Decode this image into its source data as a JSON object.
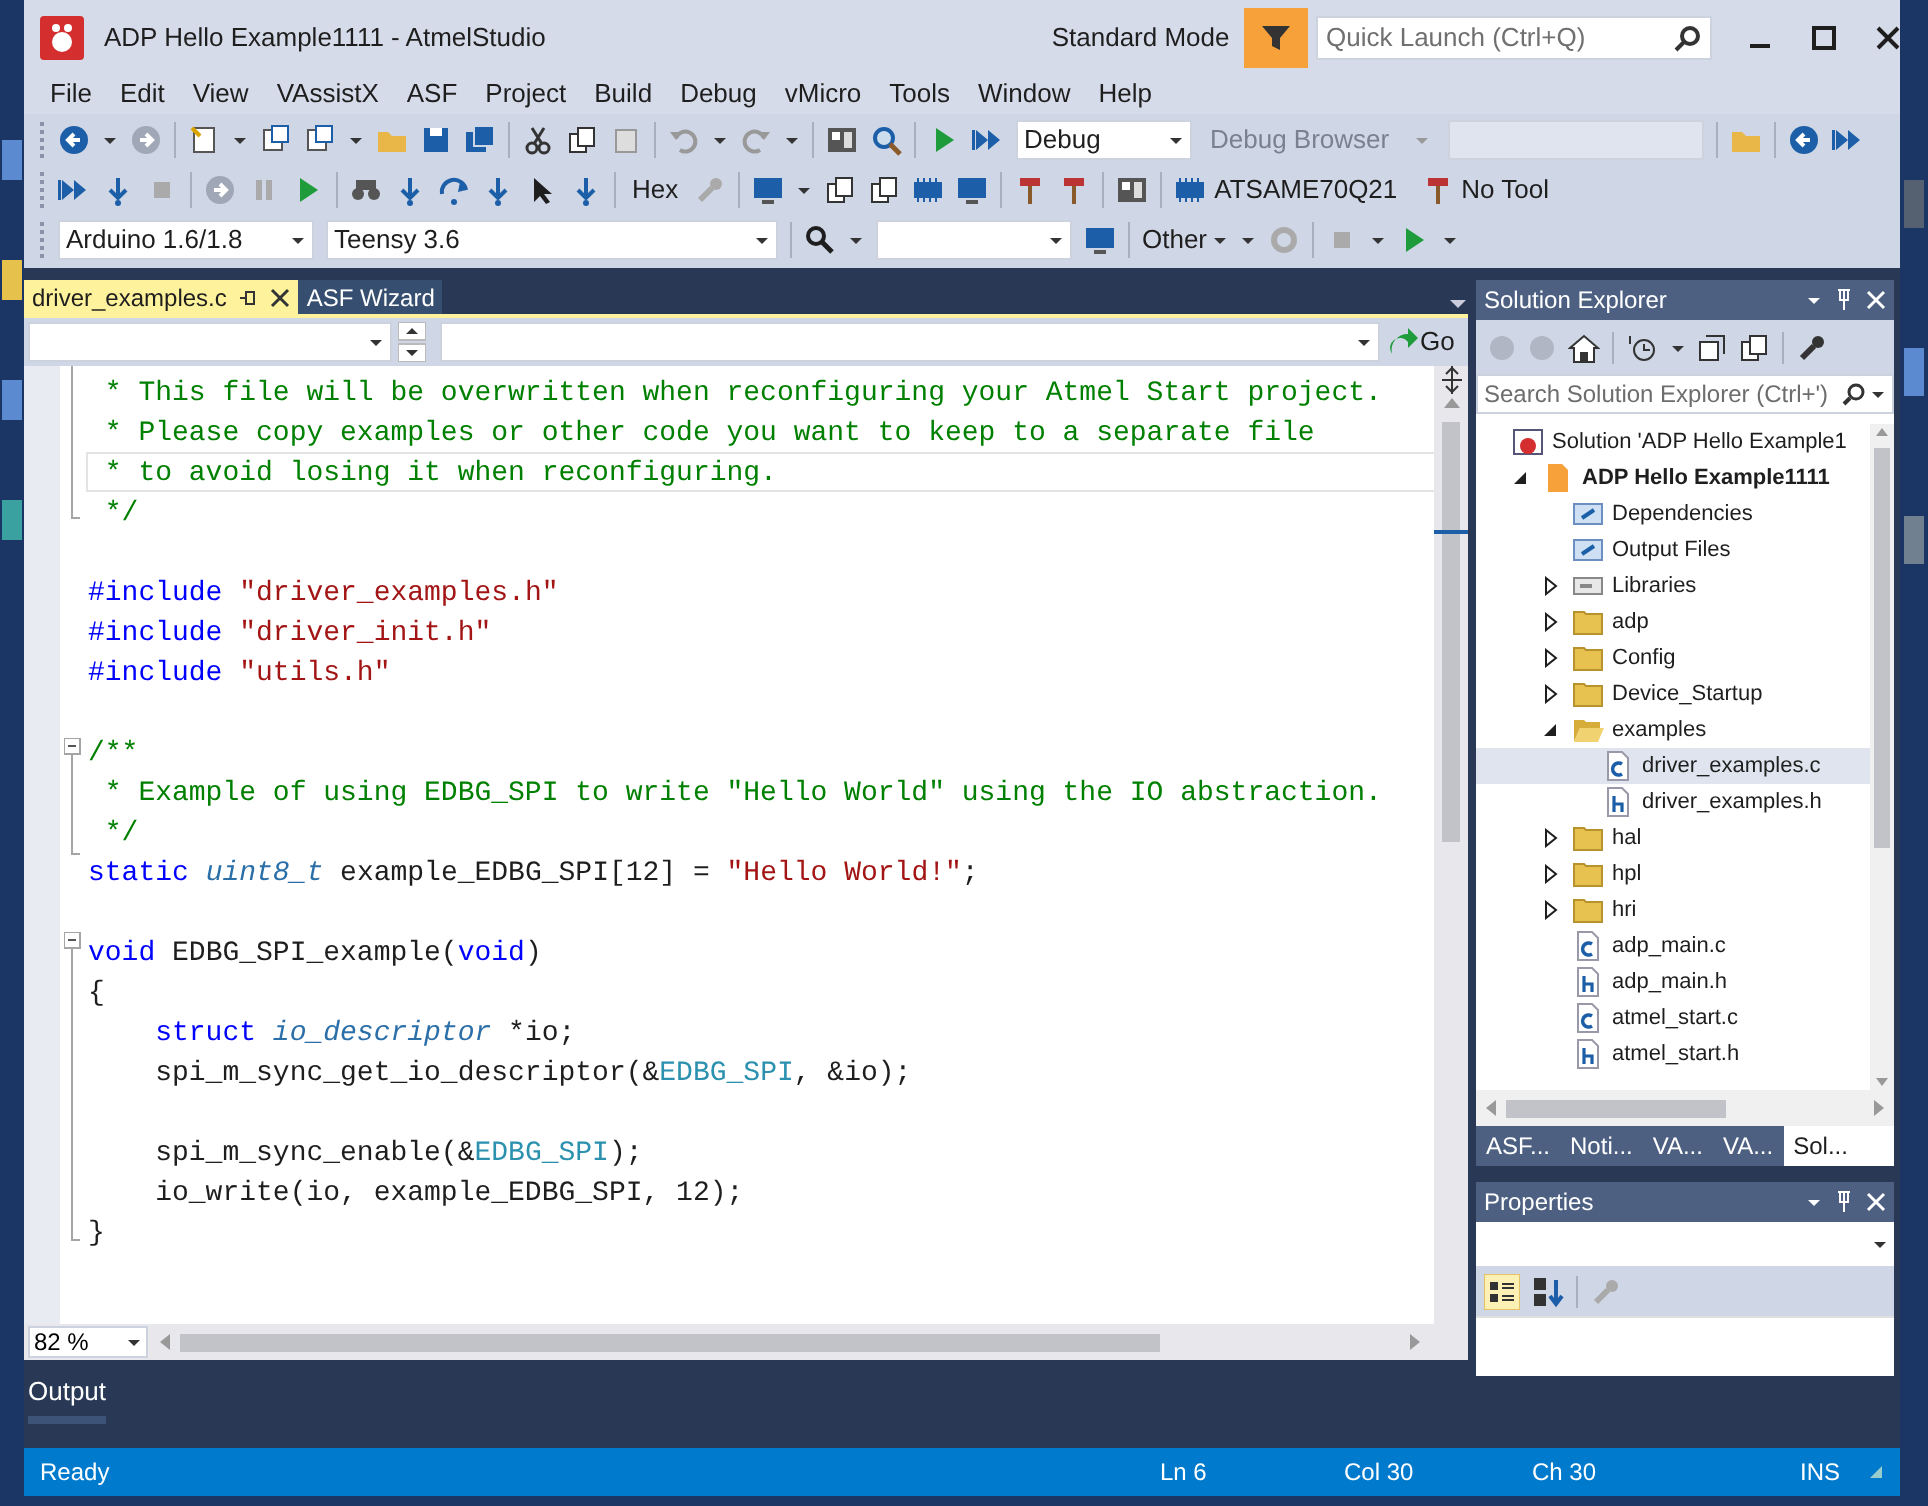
{
  "window": {
    "title": "ADP Hello Example1111 - AtmelStudio",
    "mode": "Standard Mode",
    "quick_launch": {
      "placeholder": "Quick Launch (Ctrl+Q)"
    }
  },
  "menu": [
    "File",
    "Edit",
    "View",
    "VAssistX",
    "ASF",
    "Project",
    "Build",
    "Debug",
    "vMicro",
    "Tools",
    "Window",
    "Help"
  ],
  "toolbar": {
    "configuration": "Debug",
    "debug_browser": "Debug Browser",
    "hex": "Hex",
    "device": "ATSAME70Q21",
    "tool": "No Tool",
    "board_family": "Arduino 1.6/1.8",
    "board": "Teensy 3.6",
    "other": "Other"
  },
  "editor_tabs": [
    {
      "label": "driver_examples.c",
      "selected": true
    },
    {
      "label": "ASF Wizard",
      "selected": false
    }
  ],
  "navigation": {
    "go": "Go"
  },
  "code": [
    {
      "highlighted": false,
      "tokens": [
        {
          "kind": "comment",
          "text": " * This file will be overwritten when reconfiguring your Atmel Start project."
        }
      ]
    },
    {
      "highlighted": false,
      "tokens": [
        {
          "kind": "comment",
          "text": " * Please copy examples or other code you want to keep to a separate file"
        }
      ]
    },
    {
      "highlighted": true,
      "tokens": [
        {
          "kind": "comment",
          "text": " * to avoid losing it when reconfiguring."
        }
      ]
    },
    {
      "highlighted": false,
      "tokens": [
        {
          "kind": "comment",
          "text": " */"
        }
      ]
    },
    {
      "highlighted": false
    },
    {
      "highlighted": false,
      "tokens": [
        {
          "kind": "directive",
          "text": "#include"
        },
        {
          "kind": "string",
          "text": " \"driver_examples.h\""
        }
      ]
    },
    {
      "highlighted": false,
      "tokens": [
        {
          "kind": "directive",
          "text": "#include"
        },
        {
          "kind": "string",
          "text": " \"driver_init.h\""
        }
      ]
    },
    {
      "highlighted": false,
      "tokens": [
        {
          "kind": "directive",
          "text": "#include"
        },
        {
          "kind": "string",
          "text": " \"utils.h\""
        }
      ]
    },
    {
      "highlighted": false
    },
    {
      "highlighted": false,
      "tokens": [
        {
          "kind": "comment",
          "text": "/**"
        }
      ]
    },
    {
      "highlighted": false,
      "tokens": [
        {
          "kind": "comment",
          "text": " * Example of using EDBG_SPI to write \"Hello World\" using the IO abstraction."
        }
      ]
    },
    {
      "highlighted": false,
      "tokens": [
        {
          "kind": "comment",
          "text": " */"
        }
      ]
    },
    {
      "highlighted": false,
      "tokens": [
        {
          "kind": "keyword",
          "text": "static"
        },
        {
          "kind": "type",
          "text": " uint8_t"
        },
        {
          "kind": "plain",
          "text": " example_EDBG_SPI[12] = "
        },
        {
          "kind": "string",
          "text": "\"Hello World!\""
        },
        {
          "kind": "plain",
          "text": ";"
        }
      ]
    },
    {
      "highlighted": false
    },
    {
      "highlighted": false,
      "tokens": [
        {
          "kind": "keyword",
          "text": "void"
        },
        {
          "kind": "plain",
          "text": " EDBG_SPI_example("
        },
        {
          "kind": "keyword",
          "text": "void"
        },
        {
          "kind": "plain",
          "text": ")"
        }
      ]
    },
    {
      "highlighted": false,
      "tokens": [
        {
          "kind": "plain",
          "text": "{"
        }
      ]
    },
    {
      "highlighted": false,
      "tokens": [
        {
          "kind": "keyword",
          "text": "    struct"
        },
        {
          "kind": "type",
          "text": " io_descriptor"
        },
        {
          "kind": "plain",
          "text": " *io;"
        }
      ]
    },
    {
      "highlighted": false,
      "tokens": [
        {
          "kind": "plain",
          "text": "    spi_m_sync_get_io_descriptor(&"
        },
        {
          "kind": "macro",
          "text": "EDBG_SPI"
        },
        {
          "kind": "plain",
          "text": ", &io);"
        }
      ]
    },
    {
      "highlighted": false
    },
    {
      "highlighted": false,
      "tokens": [
        {
          "kind": "plain",
          "text": "    spi_m_sync_enable(&"
        },
        {
          "kind": "macro",
          "text": "EDBG_SPI"
        },
        {
          "kind": "plain",
          "text": ");"
        }
      ]
    },
    {
      "highlighted": false,
      "tokens": [
        {
          "kind": "plain",
          "text": "    io_write(io, example_EDBG_SPI, 12);"
        }
      ]
    },
    {
      "highlighted": false,
      "tokens": [
        {
          "kind": "plain",
          "text": "}"
        }
      ]
    }
  ],
  "zoom": "82 %",
  "output_tab": "Output",
  "solution_explorer": {
    "title": "Solution Explorer",
    "search": {
      "placeholder": "Search Solution Explorer (Ctrl+')"
    },
    "tree": [
      {
        "label": "Solution 'ADP Hello Example1",
        "kind": "solution",
        "selected": false,
        "children": [
          {
            "label": "ADP Hello Example1111",
            "kind": "project",
            "selected": false,
            "expanded": true,
            "children": [
              {
                "label": "Dependencies",
                "kind": "virtual",
                "selected": false
              },
              {
                "label": "Output Files",
                "kind": "virtual",
                "selected": false
              },
              {
                "label": "Libraries",
                "kind": "library",
                "selected": false,
                "expanded": false
              },
              {
                "label": "adp",
                "kind": "folder",
                "selected": false,
                "expanded": false
              },
              {
                "label": "Config",
                "kind": "folder",
                "selected": false,
                "expanded": false
              },
              {
                "label": "Device_Startup",
                "kind": "folder",
                "selected": false,
                "expanded": false
              },
              {
                "label": "examples",
                "kind": "folder",
                "selected": false,
                "expanded": true,
                "children": [
                  {
                    "label": "driver_examples.c",
                    "kind": "file-c",
                    "selected": true
                  },
                  {
                    "label": "driver_examples.h",
                    "kind": "file-h",
                    "selected": false
                  }
                ]
              },
              {
                "label": "hal",
                "kind": "folder",
                "selected": false,
                "expanded": false
              },
              {
                "label": "hpl",
                "kind": "folder",
                "selected": false,
                "expanded": false
              },
              {
                "label": "hri",
                "kind": "folder",
                "selected": false,
                "expanded": false
              },
              {
                "label": "adp_main.c",
                "kind": "file-c",
                "selected": false
              },
              {
                "label": "adp_main.h",
                "kind": "file-h",
                "selected": false
              },
              {
                "label": "atmel_start.c",
                "kind": "file-c",
                "selected": false
              },
              {
                "label": "atmel_start.h",
                "kind": "file-h",
                "selected": false
              }
            ]
          }
        ]
      }
    ],
    "tabs": [
      {
        "label": "ASF...",
        "selected": false
      },
      {
        "label": "Noti...",
        "selected": false
      },
      {
        "label": "VA...",
        "selected": false
      },
      {
        "label": "VA...",
        "selected": false
      },
      {
        "label": "Sol...",
        "selected": true
      }
    ]
  },
  "properties": {
    "title": "Properties"
  },
  "status_bar": {
    "message": "Ready",
    "line": "Ln 6",
    "column": "Col 30",
    "char": "Ch 30",
    "mode": "INS"
  }
}
